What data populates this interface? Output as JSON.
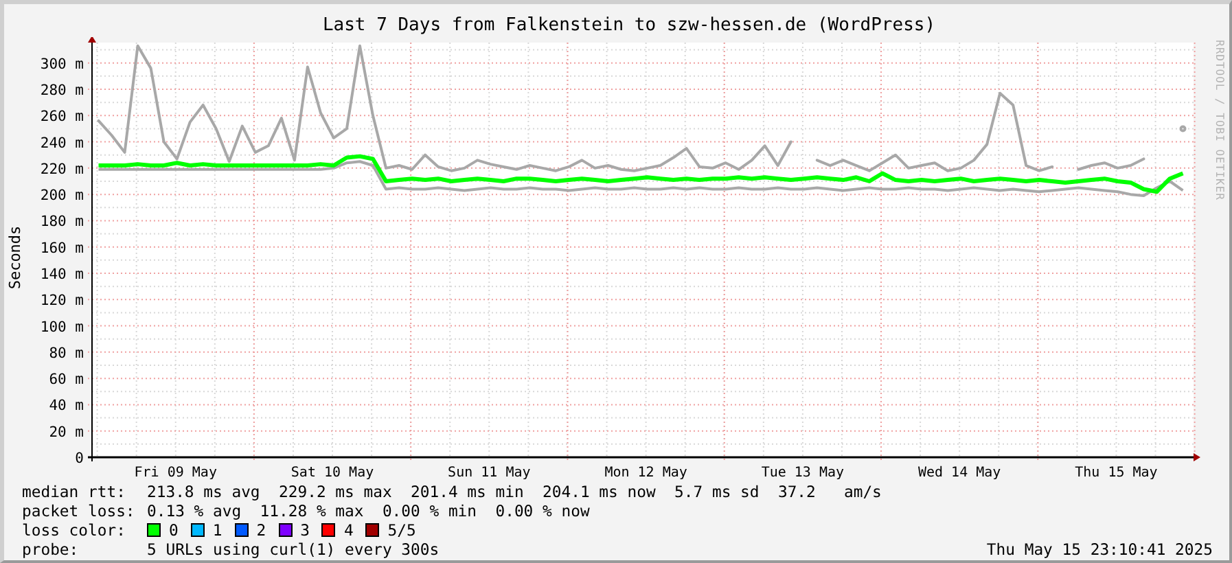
{
  "title": "Last 7 Days from Falkenstein to szw-hessen.de (WordPress)",
  "side_label": "RRDTOOL / TOBI OETIKER",
  "chart_data": {
    "type": "line",
    "ylabel": "Seconds",
    "ylim": [
      0,
      315
    ],
    "yticks": [
      {
        "value": 0,
        "label": "0"
      },
      {
        "value": 20,
        "label": "20 m"
      },
      {
        "value": 40,
        "label": "40 m"
      },
      {
        "value": 60,
        "label": "60 m"
      },
      {
        "value": 80,
        "label": "80 m"
      },
      {
        "value": 100,
        "label": "100 m"
      },
      {
        "value": 120,
        "label": "120 m"
      },
      {
        "value": 140,
        "label": "140 m"
      },
      {
        "value": 160,
        "label": "160 m"
      },
      {
        "value": 180,
        "label": "180 m"
      },
      {
        "value": 200,
        "label": "200 m"
      },
      {
        "value": 220,
        "label": "220 m"
      },
      {
        "value": 240,
        "label": "240 m"
      },
      {
        "value": 260,
        "label": "260 m"
      },
      {
        "value": 280,
        "label": "280 m"
      },
      {
        "value": 300,
        "label": "300 m"
      }
    ],
    "grid": true,
    "categories": [
      null,
      null,
      null,
      null,
      null,
      null,
      "Fri 09 May",
      null,
      null,
      null,
      null,
      null,
      null,
      null,
      null,
      null,
      null,
      null,
      "Sat 10 May",
      null,
      null,
      null,
      null,
      null,
      null,
      null,
      null,
      null,
      null,
      null,
      "Sun 11 May",
      null,
      null,
      null,
      null,
      null,
      null,
      null,
      null,
      null,
      null,
      null,
      "Mon 12 May",
      null,
      null,
      null,
      null,
      null,
      null,
      null,
      null,
      null,
      null,
      null,
      "Tue 13 May",
      null,
      null,
      null,
      null,
      null,
      null,
      null,
      null,
      null,
      null,
      null,
      "Wed 14 May",
      null,
      null,
      null,
      null,
      null,
      null,
      null,
      null,
      null,
      null,
      null,
      "Thu 15 May",
      null,
      null,
      null,
      null,
      null
    ],
    "series": [
      {
        "color": "#a8a8a8",
        "values": [
          256,
          245,
          232,
          313,
          296,
          240,
          227,
          255,
          268,
          250,
          225,
          252,
          232,
          237,
          258,
          226,
          297,
          262,
          243,
          250,
          313,
          260,
          220,
          222,
          219,
          230,
          221,
          218,
          220,
          226,
          223,
          221,
          219,
          222,
          220,
          218,
          221,
          226,
          220,
          222,
          219,
          218,
          220,
          222,
          228,
          235,
          221,
          220,
          224,
          219,
          226,
          237,
          222,
          240,
          null,
          226,
          222,
          226,
          222,
          218,
          224,
          230,
          220,
          222,
          224,
          218,
          220,
          226,
          238,
          277,
          268,
          222,
          218,
          221,
          null,
          219,
          222,
          224,
          220,
          222,
          227,
          null,
          null,
          250
        ]
      },
      {
        "color": "#a8a8a8",
        "values": [
          219,
          219,
          219,
          219,
          219,
          219,
          219,
          219,
          219,
          219,
          219,
          219,
          219,
          219,
          219,
          219,
          219,
          219,
          220,
          224,
          225,
          222,
          204,
          205,
          204,
          204,
          205,
          204,
          203,
          204,
          205,
          204,
          204,
          205,
          204,
          204,
          203,
          204,
          205,
          204,
          204,
          205,
          204,
          204,
          205,
          204,
          205,
          204,
          204,
          205,
          204,
          204,
          205,
          204,
          204,
          205,
          204,
          203,
          204,
          205,
          204,
          204,
          205,
          204,
          204,
          203,
          204,
          205,
          204,
          203,
          204,
          203,
          202,
          203,
          204,
          205,
          204,
          203,
          202,
          200,
          199,
          205,
          210,
          203
        ]
      },
      {
        "color": "#00ff00",
        "values": [
          222,
          222,
          222,
          223,
          222,
          222,
          224,
          222,
          223,
          222,
          222,
          222,
          222,
          222,
          222,
          222,
          222,
          223,
          222,
          228,
          229,
          227,
          210,
          211,
          212,
          211,
          212,
          210,
          211,
          212,
          211,
          210,
          212,
          212,
          211,
          210,
          211,
          212,
          211,
          210,
          211,
          212,
          213,
          212,
          211,
          212,
          211,
          212,
          212,
          213,
          212,
          213,
          212,
          211,
          212,
          213,
          212,
          211,
          213,
          210,
          216,
          211,
          210,
          211,
          210,
          211,
          212,
          210,
          211,
          212,
          211,
          210,
          211,
          210,
          209,
          210,
          211,
          212,
          210,
          209,
          204,
          202,
          212,
          216
        ]
      }
    ]
  },
  "stats": [
    {
      "label": "median rtt:",
      "text": "213.8 ms avg  229.2 ms max  201.4 ms min  204.1 ms now  5.7 ms sd  37.2   am/s"
    },
    {
      "label": "packet loss:",
      "text": "0.13 % avg  11.28 % max  0.00 % min  0.00 % now"
    }
  ],
  "loss_color": {
    "label": "loss color:",
    "items": [
      {
        "label": "0",
        "color": "#00ff00"
      },
      {
        "label": "1",
        "color": "#00b8ff"
      },
      {
        "label": "2",
        "color": "#0059ff"
      },
      {
        "label": "3",
        "color": "#7e00ff"
      },
      {
        "label": "4",
        "color": "#ff0000"
      },
      {
        "label": "5/5",
        "color": "#a10000"
      }
    ]
  },
  "probe": {
    "label": "probe:",
    "text": "5 URLs using curl(1) every 300s"
  },
  "timestamp": "Thu May 15 23:10:41 2025"
}
